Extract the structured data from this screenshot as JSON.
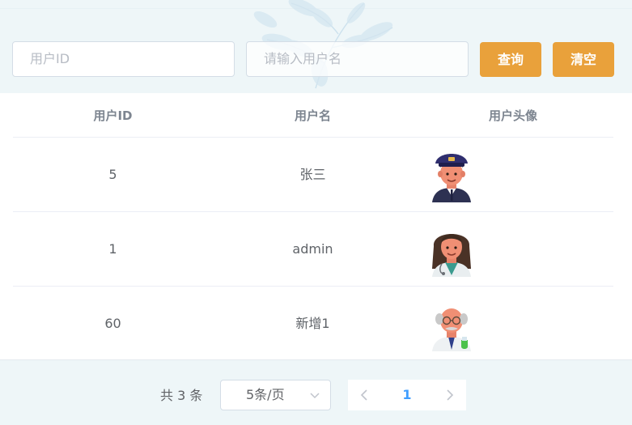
{
  "search": {
    "user_id_placeholder": "用户ID",
    "username_placeholder": "请输入用户名",
    "query_label": "查询",
    "clear_label": "清空"
  },
  "table": {
    "columns": [
      "用户ID",
      "用户名",
      "用户头像"
    ],
    "rows": [
      {
        "id": "5",
        "name": "张三",
        "avatar": "pilot-avatar-icon"
      },
      {
        "id": "1",
        "name": "admin",
        "avatar": "doctor-woman-avatar-icon"
      },
      {
        "id": "60",
        "name": "新增1",
        "avatar": "scientist-avatar-icon"
      }
    ]
  },
  "pagination": {
    "total_text": "共 3 条",
    "page_size": "5条/页",
    "current_page": "1"
  },
  "colors": {
    "accent": "#e9a13b",
    "page_active": "#409eff",
    "background": "#eef6f8"
  }
}
